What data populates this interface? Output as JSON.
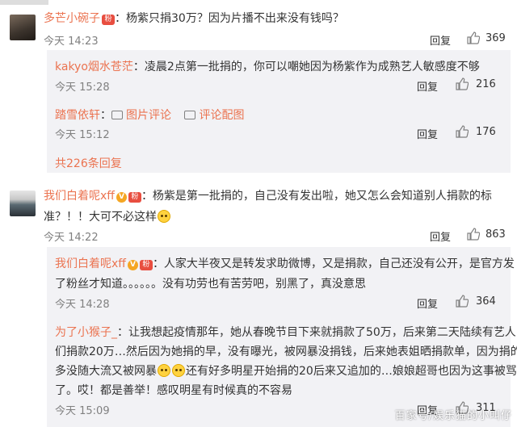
{
  "comments": [
    {
      "user": "多芒小碗子",
      "text": "：杨紫只捐30万？因为片播不出来没有钱吗？",
      "time": "今天 14:23",
      "reply_label": "回复",
      "likes": "369",
      "replies": [
        {
          "user": "kakyo烟水苍茫",
          "text": "：凌晨2点第一批捐的，你可以嘲她因为杨紫作为成熟艺人敏感度不够",
          "time": "今天 15:28",
          "reply_label": "回复",
          "likes": "216"
        },
        {
          "user": "踏雪依轩",
          "text": "：",
          "link1": "图片评论",
          "link2": "评论配图",
          "time": "今天 15:12",
          "reply_label": "回复",
          "likes": "176"
        }
      ],
      "more_replies": "共226条回复"
    },
    {
      "user": "我们白着呢xff",
      "text_line1": "：杨紫是第一批捐的，自己没有发出啦，她又怎么会知道别人捐款的标",
      "text_line2": "准？！！大可不必这样",
      "time": "今天 14:22",
      "reply_label": "回复",
      "likes": "863",
      "replies": [
        {
          "user": "我们白着呢xff",
          "text_line1": "：人家大半夜又是转发求助微博，又是捐款，自己还没有公开，是官方发",
          "text_line2": "了粉丝才知道。。。。。。没有功劳也有苦劳吧，别黑了，真没意思",
          "time": "今天 14:28",
          "reply_label": "回复",
          "likes": "364"
        },
        {
          "user": "为了小猴子_",
          "text_line1": "：让我想起疫情那年，她从春晚节目下来就捐款了50万，后来第二天陆续有艺人",
          "text_line2": "们捐款20万…然后因为她捐的早，没有曝光，被网暴没捐钱，后来她表姐晒捐款单，因为捐的",
          "text_line3a": "多没随大流又被网暴",
          "text_line3b": "还有好多明星开始捐的20后来又追加的…娘娘超哥也因为这事被骂",
          "text_line4": "了。哎！都是善举！感叹明星有时候真的不容易",
          "time": "今天 15:09",
          "reply_label": "回复",
          "likes": "311"
        }
      ]
    }
  ],
  "badges": {
    "v": "V",
    "medal": "粉"
  },
  "watermark": "百家号/娱乐猫的小叫仔",
  "colors": {
    "username": "#eb7350",
    "reply_bg": "#f2f2f5",
    "meta": "#808080"
  }
}
